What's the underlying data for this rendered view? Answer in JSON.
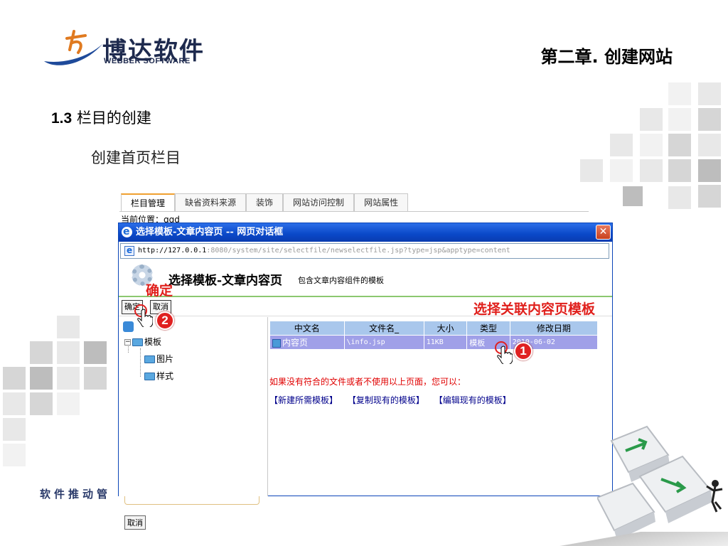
{
  "slide": {
    "logo_cn": "博达软件",
    "logo_en": "WEBBER SOFTWARE",
    "chapter_title": "第二章. 创建网站",
    "section_num": "1.3",
    "section_title": "栏目的创建",
    "subtitle": "创建首页栏目",
    "footer_text": "软件推动管"
  },
  "background_app": {
    "tabs": [
      {
        "label": "栏目管理",
        "active": true
      },
      {
        "label": "缺省资料来源",
        "active": false
      },
      {
        "label": "装饰",
        "active": false
      },
      {
        "label": "网站访问控制",
        "active": false
      },
      {
        "label": "网站属性",
        "active": false
      }
    ],
    "location_label": "当前位置：ggd",
    "cancel_label": "取消"
  },
  "dialog": {
    "title": "选择模板-文章内容页 -- 网页对话框",
    "close_glyph": "✕",
    "address_host": "http://127.0.0.1",
    "address_rest": ":8080/system/site/selectfile/newselectfile.jsp?type=jsp&apptype=content",
    "header_title": "选择模板-文章内容页",
    "header_desc": "包含文章内容组件的模板",
    "confirm_label": "确定",
    "cancel_label": "取消",
    "tree": {
      "root": "模板",
      "children": [
        "图片",
        "样式"
      ]
    },
    "table": {
      "columns": [
        "中文名",
        "文件名_",
        "大小",
        "类型",
        "修改日期"
      ],
      "rows": [
        {
          "name": "内容页",
          "file": "\\info.jsp",
          "size": "11KB",
          "type": "模板",
          "date": "2010-06-02"
        }
      ]
    },
    "notice": "如果没有符合的文件或者不使用以上页面，您可以：",
    "links": [
      "【新建所需模板】",
      "【复制现有的模板】",
      "【编辑现有的模板】"
    ]
  },
  "annotations": {
    "confirm_note": "确定",
    "select_note": "选择关联内容页模板",
    "badge_1": "1",
    "badge_2": "2"
  },
  "colors": {
    "title_bar": "#0a48c8",
    "accent_red": "#e0201c",
    "row_selected": "#a0a0e8",
    "header_border": "#8cc870"
  }
}
